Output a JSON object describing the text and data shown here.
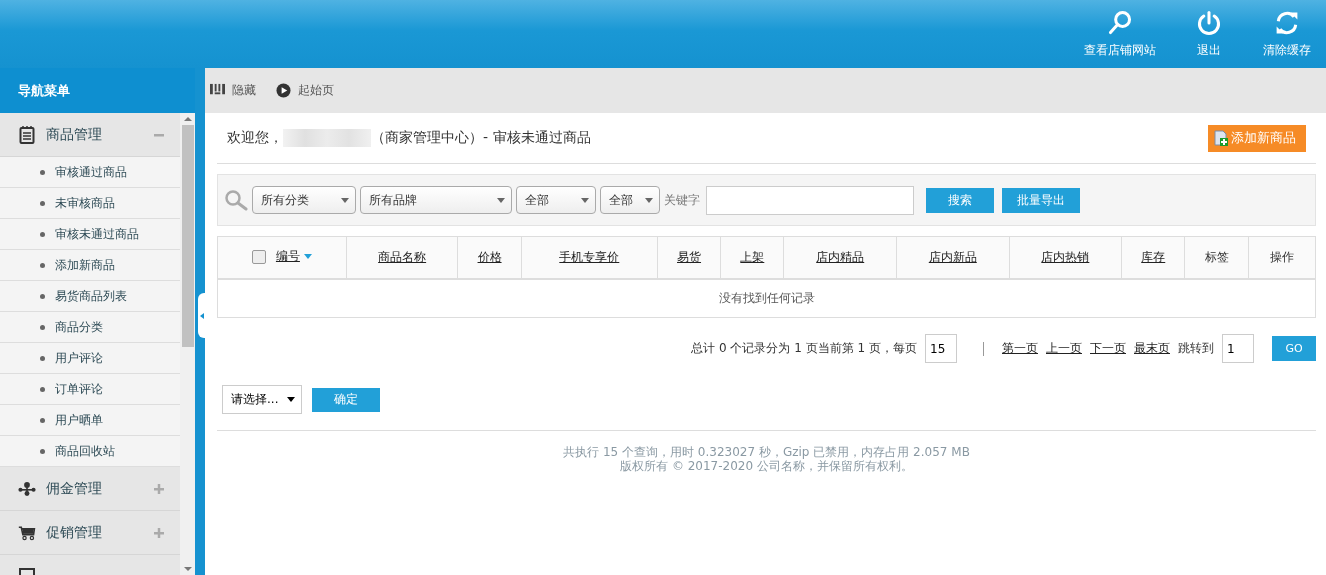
{
  "header": {
    "actions": [
      {
        "kind": "search",
        "label": "查看店铺网站"
      },
      {
        "kind": "power",
        "label": "退出"
      },
      {
        "kind": "refresh",
        "label": "清除缓存"
      }
    ]
  },
  "sidebar": {
    "title": "导航菜单",
    "groups": [
      {
        "kind": "notepad",
        "label": "商品管理",
        "expanded": true,
        "children": [
          "审核通过商品",
          "未审核商品",
          "审核未通过商品",
          "添加新商品",
          "易货商品列表",
          "商品分类",
          "用户评论",
          "订单评论",
          "用户晒单",
          "商品回收站"
        ]
      },
      {
        "kind": "network",
        "label": "佣金管理",
        "expanded": false
      },
      {
        "kind": "cart",
        "label": "促销管理",
        "expanded": false
      },
      {
        "kind": "list"
      }
    ]
  },
  "toolbar": [
    {
      "kind": "bars",
      "label": "隐藏"
    },
    {
      "kind": "play",
      "label": "起始页"
    }
  ],
  "welcome": {
    "greeting": "欢迎您，",
    "suffix": "（商家管理中心）- 审核未通过商品",
    "add_button": "添加新商品"
  },
  "filters": {
    "selects": [
      "所有分类",
      "所有品牌",
      "全部",
      "全部"
    ],
    "keyword_label": "关键字",
    "search_button": "搜索",
    "export_button": "批量导出"
  },
  "table": {
    "select_all_checked": false,
    "columns": [
      {
        "label": "编号",
        "kind": "link",
        "sorted": true
      },
      {
        "label": "商品名称",
        "kind": "link",
        "sorted": false
      },
      {
        "label": "价格",
        "kind": "link",
        "sorted": false
      },
      {
        "label": "手机专享价",
        "kind": "link",
        "sorted": false
      },
      {
        "label": "易货",
        "kind": "link",
        "sorted": false
      },
      {
        "label": "上架",
        "kind": "link",
        "sorted": false
      },
      {
        "label": "店内精品",
        "kind": "link",
        "sorted": false
      },
      {
        "label": "店内新品",
        "kind": "link",
        "sorted": false
      },
      {
        "label": "店内热销",
        "kind": "link",
        "sorted": false
      },
      {
        "label": "库存",
        "kind": "link",
        "sorted": false
      },
      {
        "label": "标签",
        "kind": "plain",
        "sorted": false
      },
      {
        "label": "操作",
        "kind": "plain",
        "sorted": false
      }
    ],
    "empty_message": "没有找到任何记录"
  },
  "pagination": {
    "summary": "总计 0 个记录分为 1 页当前第 1 页，每页",
    "page_size": "15",
    "links": [
      "第一页",
      "上一页",
      "下一页",
      "最末页"
    ],
    "jump_label": "跳转到",
    "jump_value": "1",
    "go_button": "GO"
  },
  "batch": {
    "select": "请选择...",
    "confirm_button": "确定"
  },
  "footer": {
    "lines": [
      "共执行 15 个查询，用时 0.323027 秒，Gzip 已禁用，内存占用 2.057 MB",
      "版权所有 © 2017-2020 公司名称，并保留所有权利。"
    ]
  }
}
